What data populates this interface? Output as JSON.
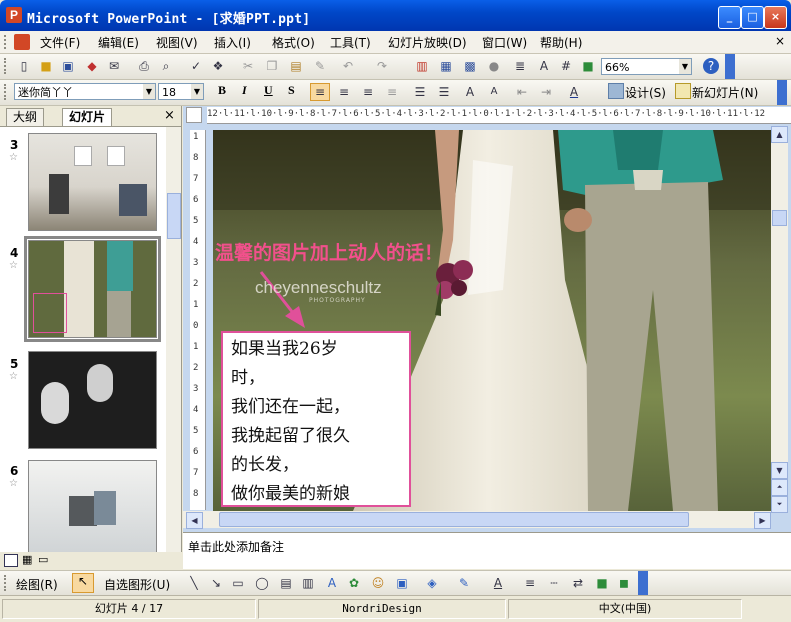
{
  "window": {
    "title": "Microsoft PowerPoint - [求婚PPT.ppt]",
    "app_icon_letter": "P",
    "minimize": "_",
    "maximize": "□",
    "close": "×"
  },
  "menu": {
    "items": [
      "文件(F)",
      "编辑(E)",
      "视图(V)",
      "插入(I)",
      "格式(O)",
      "工具(T)",
      "幻灯片放映(D)",
      "窗口(W)",
      "帮助(H)"
    ],
    "close_doc": "×"
  },
  "standard_toolbar": {
    "zoom": "66%"
  },
  "format_toolbar": {
    "font_name": "迷你简丫丫",
    "font_size": "18",
    "bold": "B",
    "italic": "I",
    "underline": "U",
    "shadow": "S",
    "design_label": "设计(S)",
    "new_slide_label": "新幻灯片(N)"
  },
  "left_panel": {
    "tabs": [
      "大纲",
      "幻灯片"
    ],
    "close": "×",
    "slides": [
      {
        "number": "3",
        "star": "☆"
      },
      {
        "number": "4",
        "star": "☆"
      },
      {
        "number": "5",
        "star": "☆"
      },
      {
        "number": "6",
        "star": "☆"
      }
    ]
  },
  "ruler": {
    "horizontal": "12·l·11·l·10·l·9·l·8·l·7·l·6·l·5·l·4·l·3·l·2·l·1·l·0·l·1·l·2·l·3·l·4·l·5·l·6·l·7·l·8·l·9·l·10·l·11·l·12",
    "vertical": [
      "1",
      "8",
      "7",
      "6",
      "5",
      "4",
      "3",
      "2",
      "1",
      "0",
      "1",
      "2",
      "3",
      "4",
      "5",
      "6",
      "7",
      "8"
    ]
  },
  "slide": {
    "watermark": "cheyenneschultz",
    "watermark_sub": "PHOTOGRAPHY",
    "headline": "温馨的图片加上动人的话！",
    "headline_color": "#F2508C",
    "poem": [
      "如果当我26岁",
      "时，",
      "我们还在一起，",
      "我挽起留了很久",
      "的长发，",
      "做你最美的新娘"
    ],
    "box_color": "#E0509A"
  },
  "notes": {
    "placeholder": "单击此处添加备注"
  },
  "drawing_toolbar": {
    "draw_label": "绘图(R)",
    "autoshapes_label": "自选图形(U)"
  },
  "status": {
    "slide_info": "幻灯片 4 / 17",
    "design": "NordriDesign",
    "language": "中文(中国)"
  }
}
